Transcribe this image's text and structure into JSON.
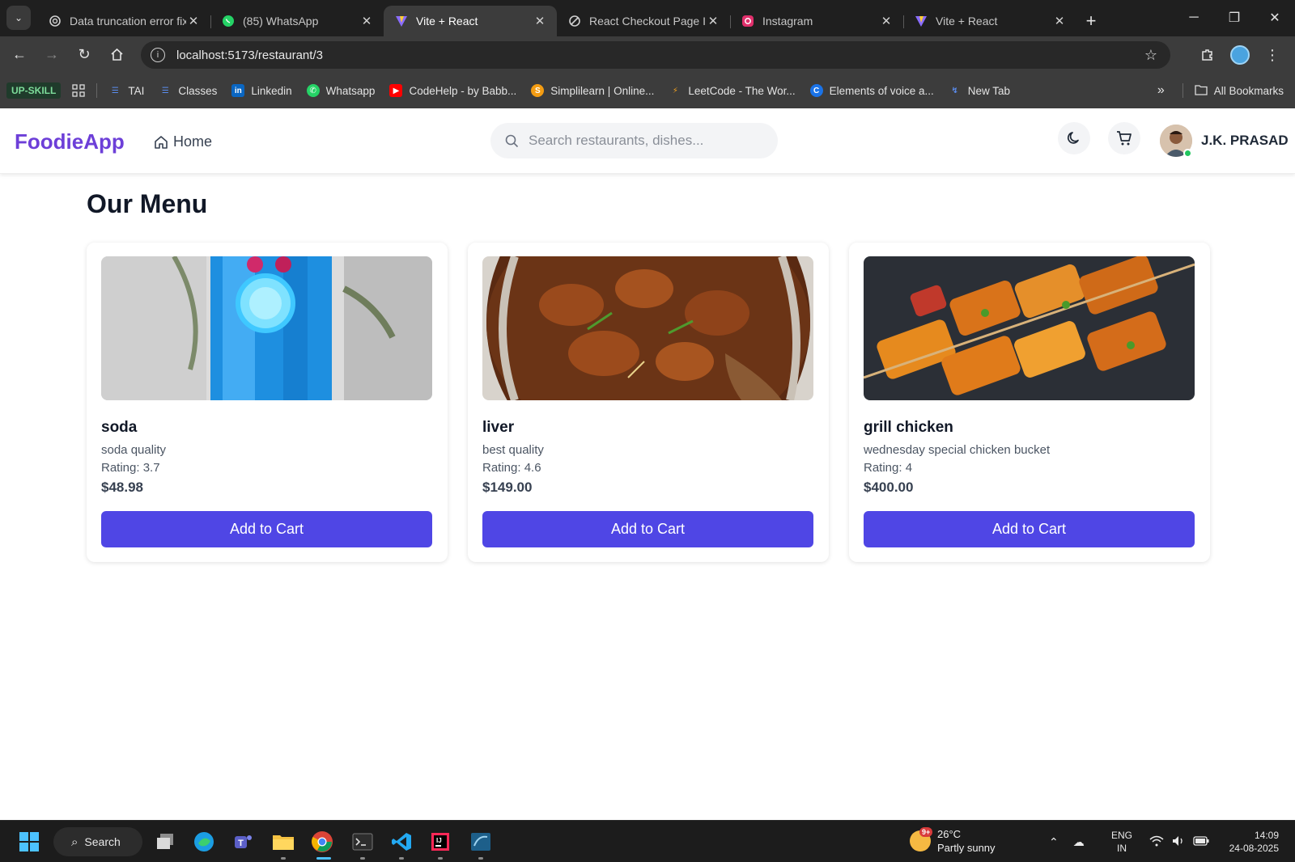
{
  "browser": {
    "tabs": [
      {
        "label": "Data truncation error fix",
        "icon": "openai-icon"
      },
      {
        "label": "(85) WhatsApp",
        "icon": "whatsapp-icon"
      },
      {
        "label": "Vite + React",
        "icon": "vite-icon",
        "active": true
      },
      {
        "label": "React Checkout Page Im",
        "icon": "chat-icon"
      },
      {
        "label": "Instagram",
        "icon": "instagram-icon"
      },
      {
        "label": "Vite + React",
        "icon": "vite-icon"
      }
    ],
    "url": "localhost:5173/restaurant/3",
    "bookmarks": [
      {
        "label": "TAI"
      },
      {
        "label": "Classes"
      },
      {
        "label": "Linkedin"
      },
      {
        "label": "Whatsapp"
      },
      {
        "label": "CodeHelp - by Babb..."
      },
      {
        "label": "Simplilearn | Online..."
      },
      {
        "label": "LeetCode - The Wor..."
      },
      {
        "label": "Elements of voice a..."
      },
      {
        "label": "New Tab"
      }
    ],
    "upskill_label": "UP-SKILL",
    "all_bookmarks": "All Bookmarks"
  },
  "app": {
    "brand": "FoodieApp",
    "brand_color": "#6d3fd8",
    "nav_home": "Home",
    "search_placeholder": "Search restaurants, dishes...",
    "user_name": "J.K. PRASAD",
    "accent_color": "#4f46e5"
  },
  "page": {
    "title": "Our Menu",
    "items": [
      {
        "name": "soda",
        "description": "soda quality",
        "rating": "Rating: 3.7",
        "price": "$48.98",
        "button": "Add to Cart"
      },
      {
        "name": "liver",
        "description": "best quality",
        "rating": "Rating: 4.6",
        "price": "$149.00",
        "button": "Add to Cart"
      },
      {
        "name": "grill chicken",
        "description": "wednesday special chicken bucket",
        "rating": "Rating: 4",
        "price": "$400.00",
        "button": "Add to Cart"
      }
    ]
  },
  "taskbar": {
    "search_label": "Search",
    "weather_temp": "26°C",
    "weather_desc": "Partly sunny",
    "weather_badge": "9+",
    "lang_line1": "ENG",
    "lang_line2": "IN",
    "time": "14:09",
    "date": "24-08-2025"
  }
}
